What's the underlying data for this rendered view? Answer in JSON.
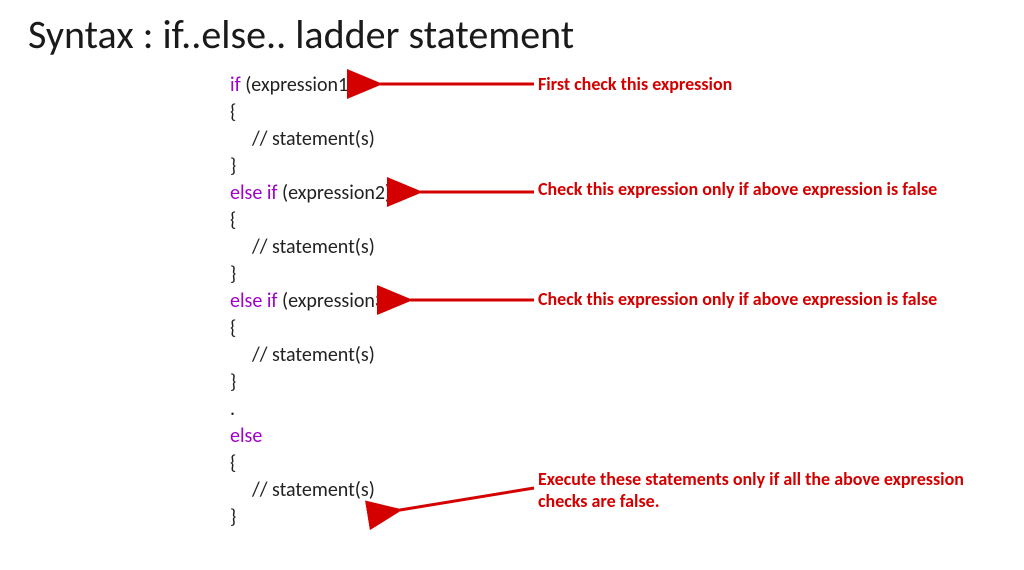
{
  "title": "Syntax : if..else.. ladder statement",
  "code": {
    "kw_if": "if",
    "kw_elseif": "else if",
    "kw_else": "else",
    "expr1": " (expression1)",
    "expr2": " (expression2)",
    "expr3": " (expression3)",
    "open": "{",
    "close": "}",
    "stmt": "// statement(s)",
    "dot": "."
  },
  "annotations": {
    "a1": "First check this expression",
    "a2": "Check this expression only if above expression is false",
    "a3": "Check this expression only if above expression is false",
    "a4": "Execute these statements only if all the above expression checks are false."
  },
  "colors": {
    "keyword": "#a000c8",
    "annotation": "#d40000",
    "text": "#222222"
  }
}
